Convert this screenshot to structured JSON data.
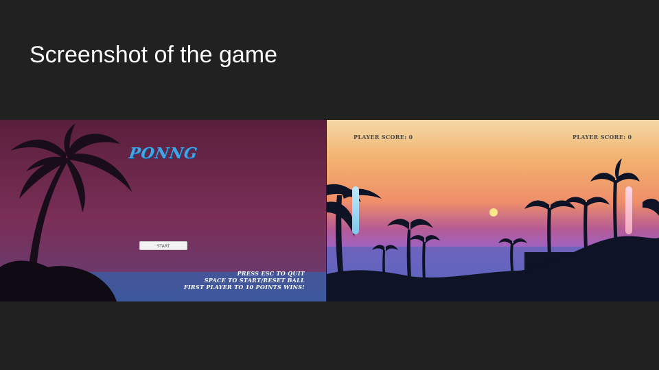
{
  "slide": {
    "title": "Screenshot of the game"
  },
  "menu": {
    "logo": "PONNG",
    "start_label": "START",
    "instructions": [
      "PRESS ESC TO QUIT",
      "SPACE TO START/RESET BALL",
      "FIRST PLAYER TO 10 POINTS WINS!"
    ]
  },
  "game": {
    "left_score_label": "PLAYER SCORE: 0",
    "right_score_label": "PLAYER SCORE: 0"
  },
  "colors": {
    "background": "#212121",
    "logo": "#3fa6e8",
    "left_paddle": "#9ad6f3",
    "right_paddle": "#f6bccb",
    "ball": "#fbe98a"
  }
}
